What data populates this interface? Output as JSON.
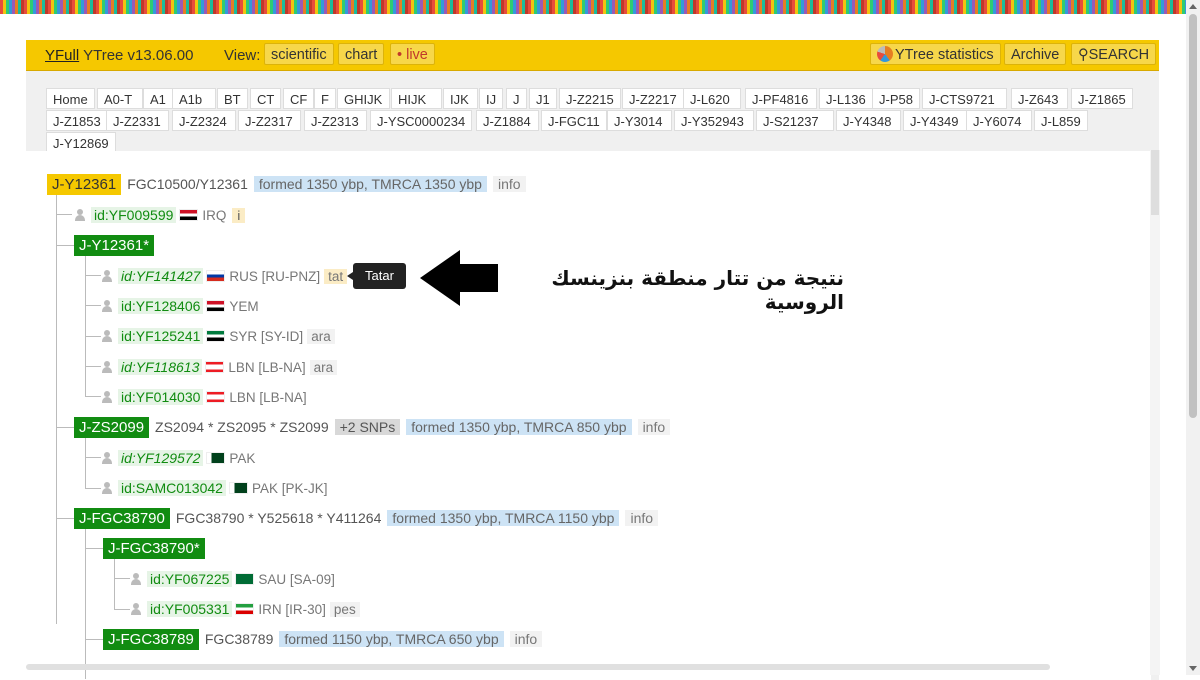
{
  "header": {
    "brand_link": "YFull",
    "brand_rest": " YTree v13.06.00",
    "view_label": "View:",
    "view_buttons": [
      "scientific",
      "chart",
      "• live"
    ],
    "right_buttons": [
      "YTree statistics",
      "Archive",
      "SEARCH"
    ],
    "colors": {
      "bar": "#f5c800",
      "node_green": "#118c11",
      "live": "#c0392b"
    }
  },
  "tabs": [
    "Home",
    "A0-T",
    "A1",
    "A1b",
    "BT",
    "CT",
    "CF",
    "F",
    "GHIJK",
    "HIJK",
    "IJK",
    "IJ",
    "J",
    "J1",
    "J-Z2215",
    "J-Z2217",
    "J-L620",
    "J-PF4816",
    "J-L136",
    "J-P58",
    "J-CTS9721",
    "J-Z643",
    "J-Z1865",
    "J-Z1853",
    "J-Z2331",
    "J-Z2324",
    "J-Z2317",
    "J-Z2313",
    "J-YSC0000234",
    "J-Z1884",
    "J-FGC11",
    "J-Y3014",
    "J-Y352943",
    "J-S21237",
    "J-Y4348",
    "J-Y4349",
    "J-Y6074",
    "J-L859",
    "J-Y12869"
  ],
  "tree": {
    "root": {
      "name": "J-Y12361",
      "snps": "FGC10500/Y12361",
      "formed": "formed 1350 ybp, TMRCA 1350 ybp",
      "info": "info"
    },
    "root_sample": {
      "id": "id:YF009599",
      "flag": "IRQ",
      "country": "IRQ",
      "extra": "i"
    },
    "y12361star": {
      "name": "J-Y12361*"
    },
    "star_samples": [
      {
        "id": "id:YF141427",
        "flag": "RUS",
        "country": "RUS [RU-PNZ]",
        "lang": "tat",
        "italic": true
      },
      {
        "id": "id:YF128406",
        "flag": "YEM",
        "country": "YEM",
        "lang": "",
        "italic": false
      },
      {
        "id": "id:YF125241",
        "flag": "SYR",
        "country": "SYR [SY-ID]",
        "lang": "ara",
        "italic": false
      },
      {
        "id": "id:YF118613",
        "flag": "LBN",
        "country": "LBN [LB-NA]",
        "lang": "ara",
        "italic": true
      },
      {
        "id": "id:YF014030",
        "flag": "LBN",
        "country": "LBN [LB-NA]",
        "lang": "",
        "italic": false
      }
    ],
    "zs2099": {
      "name": "J-ZS2099",
      "snps": "ZS2094 * ZS2095 * ZS2099",
      "plus": "+2 SNPs",
      "formed": "formed 1350 ybp, TMRCA 850 ybp",
      "info": "info"
    },
    "zs2099_samples": [
      {
        "id": "id:YF129572",
        "flag": "PAK",
        "country": "PAK",
        "italic": true
      },
      {
        "id": "id:SAMC013042",
        "flag": "PAK",
        "country": "PAK [PK-JK]",
        "italic": false
      }
    ],
    "fgc38790": {
      "name": "J-FGC38790",
      "snps": "FGC38790 * Y525618 * Y411264",
      "formed": "formed 1350 ybp, TMRCA 1150 ybp",
      "info": "info"
    },
    "fgc38790star": {
      "name": "J-FGC38790*"
    },
    "fgc38790star_samples": [
      {
        "id": "id:YF067225",
        "flag": "SAU",
        "country": "SAU [SA-09]",
        "lang": ""
      },
      {
        "id": "id:YF005331",
        "flag": "IRN",
        "country": "IRN [IR-30]",
        "lang": "pes"
      }
    ],
    "fgc38789": {
      "name": "J-FGC38789",
      "snps": "FGC38789",
      "formed": "formed 1150 ybp, TMRCA 650 ybp",
      "info": "info"
    }
  },
  "tooltip": "Tatar",
  "annotation": "نتيجة من تتار منطقة بنزينسك الروسية"
}
